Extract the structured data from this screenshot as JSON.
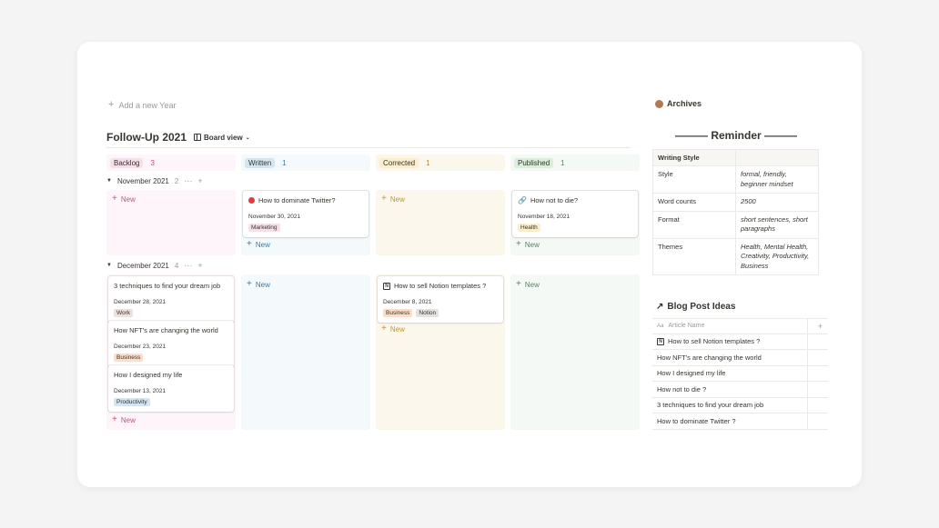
{
  "add_year_label": "Add a new Year",
  "board": {
    "title": "Follow-Up 2021",
    "view_label": "Board view"
  },
  "columns": [
    {
      "name": "Backlog",
      "count": "3",
      "bg": "#fdf5f9",
      "tag_bg": "#f5e0e9",
      "text": "#37352f",
      "count_color": "#c14c8a",
      "new_color": "#d44c80"
    },
    {
      "name": "Written",
      "count": "1",
      "bg": "#f4f9fc",
      "tag_bg": "#d3e5ef",
      "text": "#37352f",
      "count_color": "#2f7fb3",
      "new_color": "#2f7fb3"
    },
    {
      "name": "Corrected",
      "count": "1",
      "bg": "#fbf7ec",
      "tag_bg": "#fbeecc",
      "text": "#37352f",
      "count_color": "#b58a2b",
      "new_color": "#c9922a"
    },
    {
      "name": "Published",
      "count": "1",
      "bg": "#f5f9f6",
      "tag_bg": "#dbeddb",
      "text": "#37352f",
      "count_color": "#4f8a5b",
      "new_color": "#4f8a5b"
    }
  ],
  "groups": [
    {
      "name": "November 2021",
      "count": "2",
      "cards": {
        "written": {
          "title": "How to dominate Twitter?",
          "date": "November 30, 2021",
          "tags": [
            {
              "label": "Marketing",
              "bg": "#f5e0e9"
            }
          ]
        },
        "published": {
          "title": "How not to die?",
          "date": "November 18, 2021",
          "tags": [
            {
              "label": "Health",
              "bg": "#fbeecc"
            }
          ]
        }
      }
    },
    {
      "name": "December 2021",
      "count": "4",
      "cards": {
        "backlog": [
          {
            "title": "3 techniques to find your dream job",
            "date": "December 28, 2021",
            "tags": [
              {
                "label": "Work",
                "bg": "#eee0da"
              }
            ]
          },
          {
            "title": "How NFT's are changing the world",
            "date": "December 23, 2021",
            "tags": [
              {
                "label": "Business",
                "bg": "#fadec9"
              }
            ]
          },
          {
            "title": "How I designed my life",
            "date": "December 13, 2021",
            "tags": [
              {
                "label": "Productivity",
                "bg": "#d3e5ef"
              }
            ]
          }
        ],
        "corrected": {
          "title": "How to sell Notion templates ?",
          "date": "December 8, 2021",
          "tags": [
            {
              "label": "Business",
              "bg": "#fadec9"
            },
            {
              "label": "Notion",
              "bg": "#e3e2e0"
            }
          ]
        }
      }
    }
  ],
  "new_label": "New",
  "archives_label": "Archives",
  "reminder": {
    "title": "——— Reminder ———",
    "header": "Writing Style",
    "rows": [
      {
        "key": "Style",
        "value": "formal, friendly, beginner mindset"
      },
      {
        "key": "Word counts",
        "value": "2500"
      },
      {
        "key": "Format",
        "value": "short sentences, short paragraphs"
      },
      {
        "key": "Themes",
        "value": "Health, Mental Health, Creativity, Productivity, Business"
      }
    ]
  },
  "blog_ideas": {
    "title": "Blog Post Ideas",
    "column_header": "Article Name",
    "column_icon": "Aa",
    "rows": [
      "How to sell Notion templates ?",
      "How NFT's are changing the world",
      "How I designed my life",
      "How not to die ?",
      "3 techniques to find your dream job",
      "How to dominate Twitter ?"
    ]
  }
}
